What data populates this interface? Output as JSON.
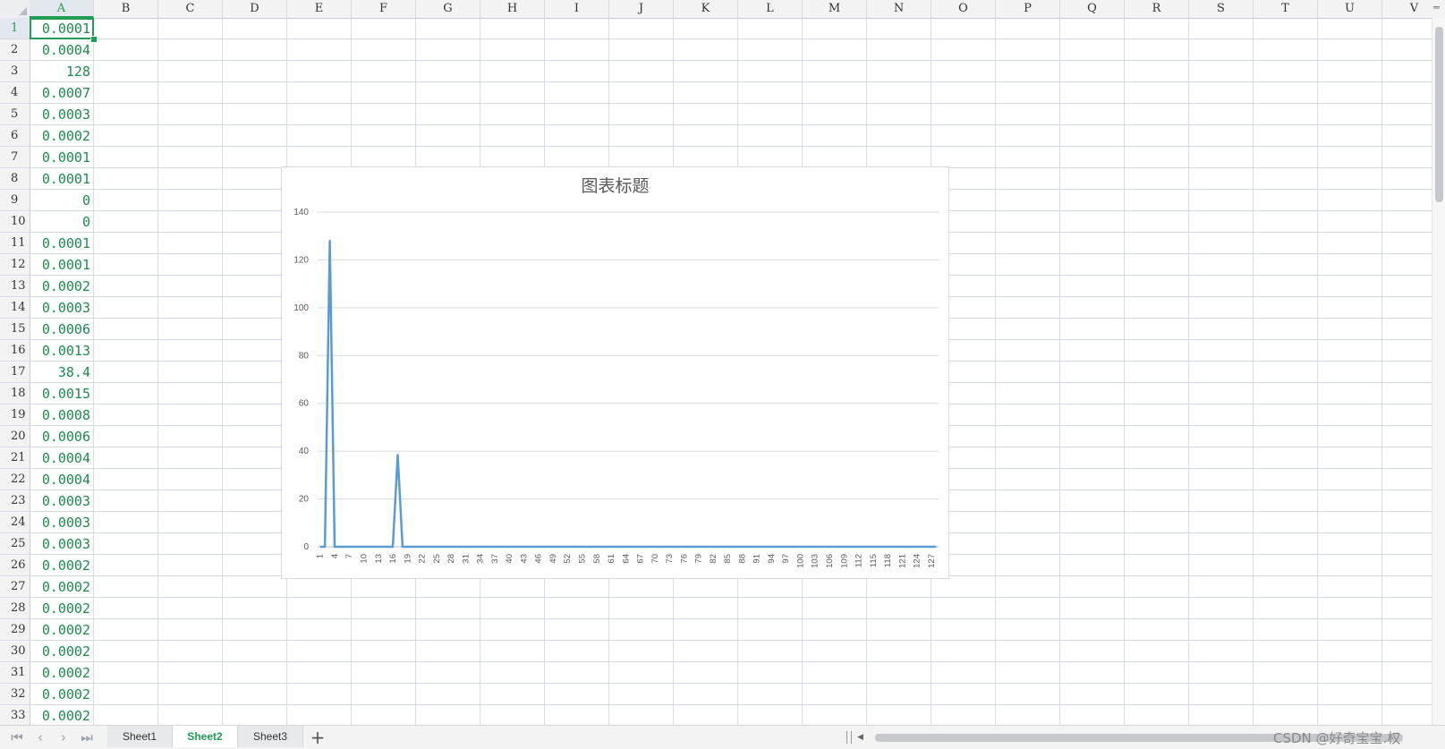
{
  "columns": [
    "A",
    "B",
    "C",
    "D",
    "E",
    "F",
    "G",
    "H",
    "I",
    "J",
    "K",
    "L",
    "M",
    "N",
    "O",
    "P",
    "Q",
    "R",
    "S",
    "T",
    "U",
    "V"
  ],
  "rows": [
    "1",
    "2",
    "3",
    "4",
    "5",
    "6",
    "7",
    "8",
    "9",
    "10",
    "11",
    "12",
    "13",
    "14",
    "15",
    "16",
    "17",
    "18",
    "19",
    "20",
    "21",
    "22",
    "23",
    "24",
    "25",
    "26",
    "27",
    "28",
    "29",
    "30",
    "31",
    "32",
    "33"
  ],
  "active_cell": "A1",
  "column_a_values": [
    "0.0001",
    "0.0004",
    "128",
    "0.0007",
    "0.0003",
    "0.0002",
    "0.0001",
    "0.0001",
    "0",
    "0",
    "0.0001",
    "0.0001",
    "0.0002",
    "0.0003",
    "0.0006",
    "0.0013",
    "38.4",
    "0.0015",
    "0.0008",
    "0.0006",
    "0.0004",
    "0.0004",
    "0.0003",
    "0.0003",
    "0.0003",
    "0.0002",
    "0.0002",
    "0.0002",
    "0.0002",
    "0.0002",
    "0.0002",
    "0.0002",
    "0.0002"
  ],
  "chart_data": {
    "type": "line",
    "title": "图表标题",
    "xlabel": "",
    "ylabel": "",
    "ylim": [
      0,
      140
    ],
    "yticks": [
      0,
      20,
      40,
      60,
      80,
      100,
      120,
      140
    ],
    "x_count": 128,
    "x_tick_labels": [
      "1",
      "4",
      "7",
      "10",
      "13",
      "16",
      "19",
      "22",
      "25",
      "28",
      "31",
      "34",
      "37",
      "40",
      "43",
      "46",
      "49",
      "52",
      "55",
      "58",
      "61",
      "64",
      "67",
      "70",
      "73",
      "76",
      "79",
      "82",
      "85",
      "88",
      "91",
      "94",
      "97",
      "100",
      "103",
      "106",
      "109",
      "112",
      "115",
      "118",
      "121",
      "124",
      "127"
    ],
    "series": [
      {
        "color": "#5b9bd5",
        "points": [
          [
            1,
            0.0001
          ],
          [
            2,
            0.0004
          ],
          [
            3,
            128
          ],
          [
            4,
            0.0007
          ],
          [
            5,
            0.0003
          ],
          [
            6,
            0.0002
          ],
          [
            7,
            0.0001
          ],
          [
            8,
            0.0001
          ],
          [
            9,
            0
          ],
          [
            10,
            0
          ],
          [
            11,
            0.0001
          ],
          [
            12,
            0.0001
          ],
          [
            13,
            0.0002
          ],
          [
            14,
            0.0003
          ],
          [
            15,
            0.0006
          ],
          [
            16,
            0.0013
          ],
          [
            17,
            38.4
          ],
          [
            18,
            0.0015
          ],
          [
            19,
            0.0008
          ],
          [
            20,
            0.0006
          ],
          [
            21,
            0.0004
          ],
          [
            22,
            0.0004
          ],
          [
            23,
            0.0003
          ],
          [
            24,
            0.0003
          ],
          [
            25,
            0.0003
          ],
          [
            26,
            0.0002
          ],
          [
            27,
            0.0002
          ],
          [
            28,
            0.0002
          ],
          [
            29,
            0.0002
          ],
          [
            30,
            0.0002
          ],
          [
            31,
            0.0002
          ],
          [
            32,
            0.0002
          ],
          [
            33,
            0.0002
          ],
          [
            128,
            0
          ]
        ]
      }
    ],
    "grid": true,
    "legend": "none"
  },
  "sheet_tabs": [
    "Sheet1",
    "Sheet2",
    "Sheet3"
  ],
  "active_sheet": "Sheet2",
  "add_sheet_label": "+",
  "nav_icons": {
    "first": "⏮",
    "prev": "‹",
    "next": "›",
    "last": "⏭"
  },
  "watermark": "CSDN @好奇宝宝.权"
}
